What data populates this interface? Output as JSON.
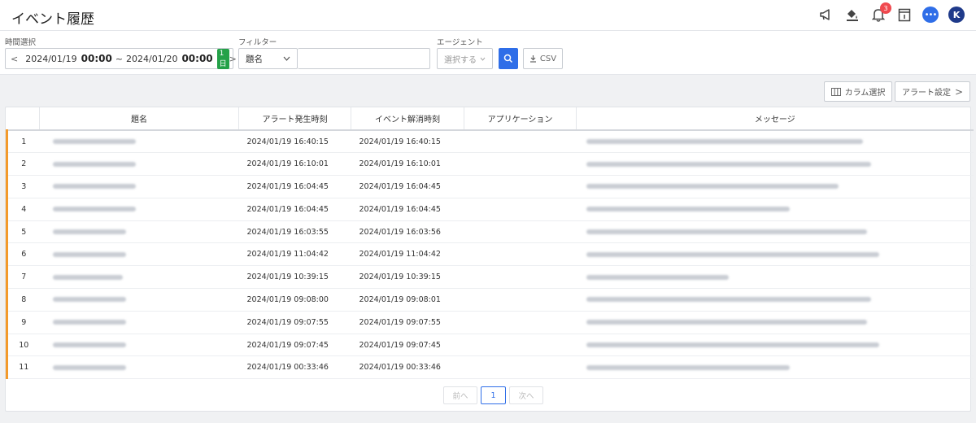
{
  "header": {
    "title": "イベント履歴",
    "notification_count": "3",
    "user_initial": "K",
    "icons": [
      "megaphone-icon",
      "paint-bucket-icon",
      "bell-icon",
      "calendar-icon",
      "chat-icon"
    ]
  },
  "filters": {
    "time_label": "時間選択",
    "time_start_date": "2024/01/19",
    "time_start_hm": "00:00",
    "time_sep": "~",
    "time_end_date": "2024/01/20",
    "time_end_hm": "00:00",
    "time_range_badge": "1日",
    "filter_label": "フィルター",
    "filter_field": "題名",
    "filter_value": "",
    "agent_label": "エージェント",
    "agent_placeholder": "選択する",
    "csv_label": "CSV"
  },
  "toolbar": {
    "column_select": "カラム選択",
    "alert_settings": "アラート設定"
  },
  "table": {
    "columns": [
      "題名",
      "アラート発生時刻",
      "イベント解消時刻",
      "アプリケーション",
      "メッセージ"
    ],
    "rows": [
      {
        "no": "1",
        "occurred": "2024/01/19 16:40:15",
        "resolved": "2024/01/19 16:40:15",
        "t": 1,
        "m": 1
      },
      {
        "no": "2",
        "occurred": "2024/01/19 16:10:01",
        "resolved": "2024/01/19 16:10:01",
        "t": 1,
        "m": 1
      },
      {
        "no": "3",
        "occurred": "2024/01/19 16:04:45",
        "resolved": "2024/01/19 16:04:45",
        "t": 1,
        "m": 1
      },
      {
        "no": "4",
        "occurred": "2024/01/19 16:04:45",
        "resolved": "2024/01/19 16:04:45",
        "t": 1,
        "m": 1
      },
      {
        "no": "5",
        "occurred": "2024/01/19 16:03:55",
        "resolved": "2024/01/19 16:03:56",
        "t": 1,
        "m": 1
      },
      {
        "no": "6",
        "occurred": "2024/01/19 11:04:42",
        "resolved": "2024/01/19 11:04:42",
        "t": 1,
        "m": 1
      },
      {
        "no": "7",
        "occurred": "2024/01/19 10:39:15",
        "resolved": "2024/01/19 10:39:15",
        "t": 1,
        "m": 1
      },
      {
        "no": "8",
        "occurred": "2024/01/19 09:08:00",
        "resolved": "2024/01/19 09:08:01",
        "t": 1,
        "m": 1
      },
      {
        "no": "9",
        "occurred": "2024/01/19 09:07:55",
        "resolved": "2024/01/19 09:07:55",
        "t": 1,
        "m": 1
      },
      {
        "no": "10",
        "occurred": "2024/01/19 09:07:45",
        "resolved": "2024/01/19 09:07:45",
        "t": 1,
        "m": 1
      },
      {
        "no": "11",
        "occurred": "2024/01/19 00:33:46",
        "resolved": "2024/01/19 00:33:46",
        "t": 1,
        "m": 1
      }
    ]
  },
  "pagination": {
    "prev": "前へ",
    "current": "1",
    "next": "次へ"
  },
  "colors": {
    "accent": "#2f6ee8",
    "row_marker": "#f39a2b",
    "badge_green": "#24a148",
    "notification": "#f0494f"
  }
}
